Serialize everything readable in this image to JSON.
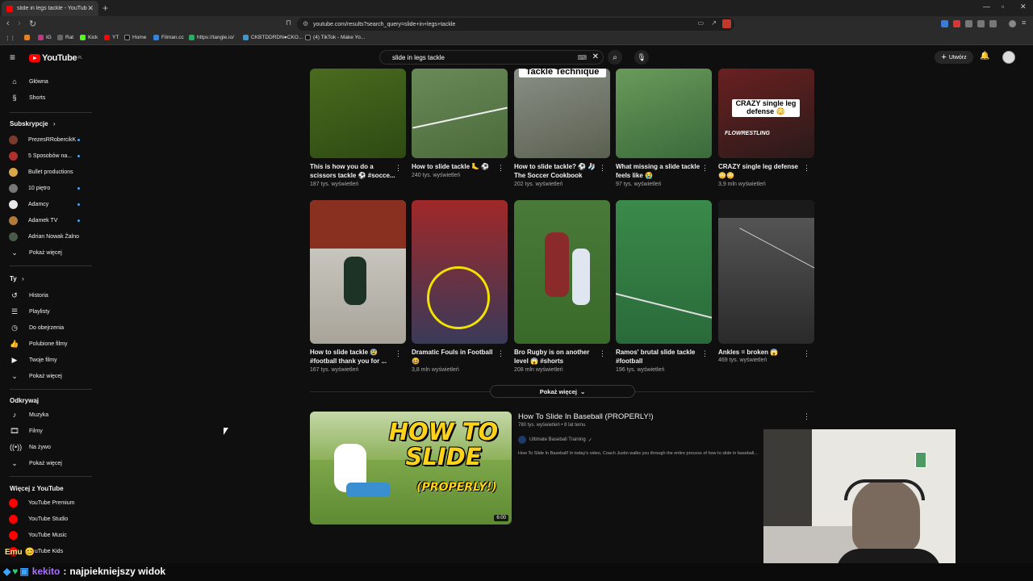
{
  "browser": {
    "tab_title": "slide in legs tackle - YouTube",
    "url": "youtube.com/results?search_query=slide+in+legs+tackle",
    "bookmarks": [
      "IG",
      "Rat",
      "Kick",
      "YT",
      "Home",
      "Filman.cc",
      "https://tangle.io/",
      "CKBTDDRDN●CKO...",
      "(4) TikTok - Make Yo..."
    ]
  },
  "header": {
    "logo": "YouTube",
    "region": "PL",
    "search_value": "slide in legs tackle",
    "create_label": "Utwórz"
  },
  "sidebar": {
    "main": [
      {
        "label": "Główna",
        "icon": "home-icon"
      },
      {
        "label": "Shorts",
        "icon": "shorts-icon"
      }
    ],
    "subscriptions_title": "Subskrypcje",
    "subscriptions": [
      {
        "label": "PrezesRRobercikK",
        "color": "#7a3b2e",
        "live": true
      },
      {
        "label": "5 Sposobów na...",
        "color": "#b03030",
        "live": true
      },
      {
        "label": "Bullet productions",
        "color": "#d9a44a",
        "live": false
      },
      {
        "label": "10 piętro",
        "color": "#777777",
        "live": true
      },
      {
        "label": "Adamcy",
        "color": "#e8e8e8",
        "live": true
      },
      {
        "label": "Adamek TV",
        "color": "#b07a3a",
        "live": true
      },
      {
        "label": "Adrian Nowak Żalno",
        "color": "#4a5a4a",
        "live": false
      }
    ],
    "subs_more": "Pokaż więcej",
    "you_title": "Ty",
    "you": [
      {
        "label": "Historia",
        "icon": "history-icon"
      },
      {
        "label": "Playlisty",
        "icon": "playlists-icon"
      },
      {
        "label": "Do obejrzenia",
        "icon": "watch-later-icon"
      },
      {
        "label": "Polubione filmy",
        "icon": "like-icon"
      },
      {
        "label": "Twoje filmy",
        "icon": "your-videos-icon"
      },
      {
        "label": "Pokaż więcej",
        "icon": "chevron-down-icon"
      }
    ],
    "explore_title": "Odkrywaj",
    "explore": [
      {
        "label": "Muzyka",
        "icon": "music-icon"
      },
      {
        "label": "Filmy",
        "icon": "movies-icon"
      },
      {
        "label": "Na żywo",
        "icon": "live-icon"
      },
      {
        "label": "Pokaż więcej",
        "icon": "chevron-down-icon"
      }
    ],
    "more_title": "Więcej z YouTube",
    "more": [
      {
        "label": "YouTube Premium"
      },
      {
        "label": "YouTube Studio"
      },
      {
        "label": "YouTube Music"
      },
      {
        "label": "YouTube Kids"
      }
    ]
  },
  "shorts_row1": [
    {
      "title": "This is how you do a scissors tackle ⚽ #socce...",
      "views": "187 tys. wyświetleń",
      "colors": [
        "#4a6b1f",
        "#2e4a12"
      ]
    },
    {
      "title": "How to slide tackle 🦶 ⚽",
      "views": "240 tys. wyświetleń",
      "colors": [
        "#6b8a5a",
        "#4a6a3a"
      ]
    },
    {
      "title": "How to slide tackle? ⚽ 🧦 The Soccer Cookbook",
      "views": "202 tys. wyświetleń",
      "colors": [
        "#8a8f86",
        "#5a6050"
      ],
      "overlay": "Tackle Technique"
    },
    {
      "title": "What missing a slide tackle feels like 😭",
      "views": "97 tys. wyświetleń",
      "colors": [
        "#6a9a5a",
        "#3a6a3a"
      ]
    },
    {
      "title": "CRAZY single leg defense 😳😳",
      "views": "3,9 mln wyświetleń",
      "colors": [
        "#6a2020",
        "#2a1a1a"
      ],
      "overlay": "CRAZY single leg defense 😳",
      "badge": "FLOWRESTLING"
    }
  ],
  "shorts_row2": [
    {
      "title": "How to slide tackle 😰 #football thank you for ...",
      "views": "167 tys. wyświetleń",
      "colors": [
        "#d8d6d0",
        "#a8a49a"
      ]
    },
    {
      "title": "Dramatic Fouls in Football 😆",
      "views": "3,8 mln wyświetleń",
      "colors": [
        "#a02828",
        "#3a3a5a"
      ]
    },
    {
      "title": "Bro Rugby is on another level 😱 #shorts",
      "views": "208 mln wyświetleń",
      "colors": [
        "#4a7a3a",
        "#3a6a2a"
      ]
    },
    {
      "title": "Ramos' brutal slide tackle #football",
      "views": "196 tys. wyświetleń",
      "colors": [
        "#3a8a4a",
        "#2a6a3a"
      ]
    },
    {
      "title": "Ankles = broken 😱",
      "views": "469 tys. wyświetleń",
      "colors": [
        "#5a5a5a",
        "#2a2a2a"
      ]
    }
  ],
  "show_more_label": "Pokaż więcej",
  "video": {
    "title": "How To Slide In Baseball (PROPERLY!)",
    "meta": "780 tys. wyświetleń • 8 lat temu",
    "channel": "Ultimate Baseball Training",
    "description": "How To Slide In Baseball! In today's video, Coach Justin walks you through the entire process of how to slide in baseball...",
    "duration": "6:00",
    "thumb_line1": "HOW TO",
    "thumb_line2": "SLIDE",
    "thumb_line3": "(PROPERLY!)"
  },
  "chat": {
    "user": "Emu",
    "emotes": "😊",
    "user2": "kekito",
    "message": "najpiekniejszy widok"
  }
}
